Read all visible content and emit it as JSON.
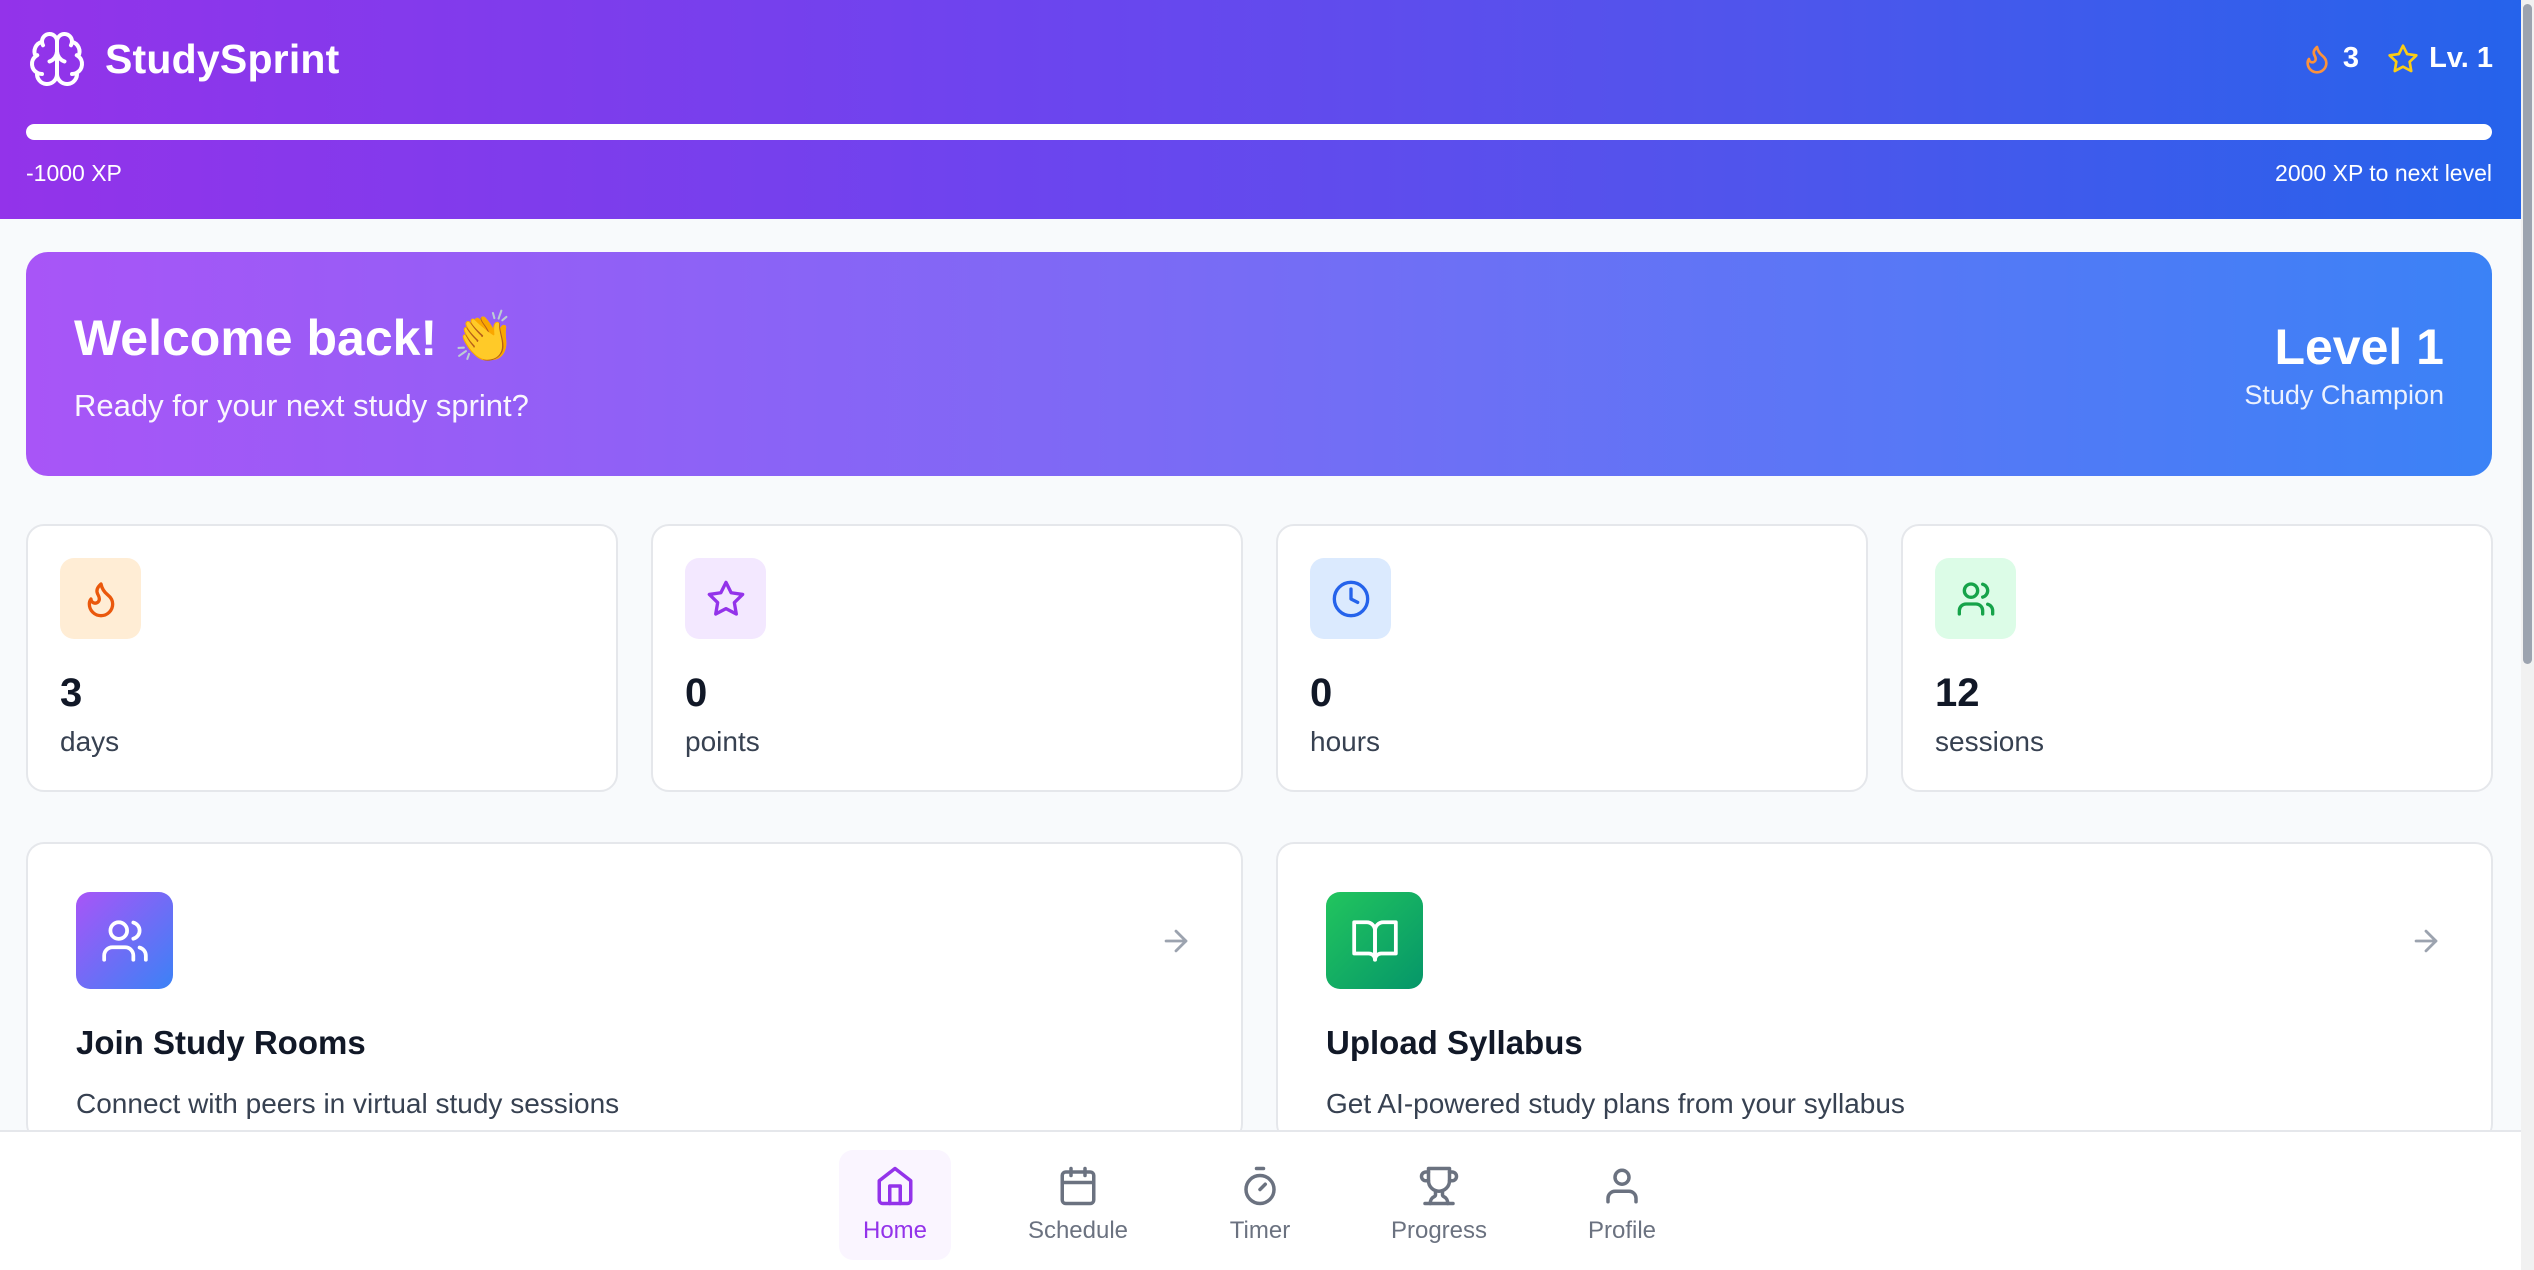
{
  "header": {
    "app_name": "StudySprint",
    "streak": "3",
    "level_badge": "Lv. 1",
    "xp_progress": 1.0,
    "xp_left": "-1000 XP",
    "xp_right": "2000 XP to next level"
  },
  "welcome": {
    "title": "Welcome back!",
    "emoji": "👏",
    "subtitle": "Ready for your next study sprint?",
    "level": "Level 1",
    "rank": "Study Champion"
  },
  "stats": [
    {
      "value": "3",
      "label": "days",
      "icon": "flame-icon",
      "color": "#ea580c",
      "bg": "#ffedd5"
    },
    {
      "value": "0",
      "label": "points",
      "icon": "star-icon",
      "color": "#9333ea",
      "bg": "#f3e8ff"
    },
    {
      "value": "0",
      "label": "hours",
      "icon": "clock-icon",
      "color": "#2563eb",
      "bg": "#dbeafe"
    },
    {
      "value": "12",
      "label": "sessions",
      "icon": "users-icon",
      "color": "#16a34a",
      "bg": "#dcfce7"
    }
  ],
  "actions": [
    {
      "title": "Join Study Rooms",
      "description": "Connect with peers in virtual study sessions",
      "icon": "users-icon"
    },
    {
      "title": "Upload Syllabus",
      "description": "Get AI-powered study plans from your syllabus",
      "icon": "book-open-icon"
    }
  ],
  "nav": [
    {
      "label": "Home",
      "icon": "home-icon",
      "active": true
    },
    {
      "label": "Schedule",
      "icon": "calendar-icon",
      "active": false
    },
    {
      "label": "Timer",
      "icon": "timer-icon",
      "active": false
    },
    {
      "label": "Progress",
      "icon": "trophy-icon",
      "active": false
    },
    {
      "label": "Profile",
      "icon": "user-icon",
      "active": false
    }
  ],
  "colors": {
    "accent": "#9333ea",
    "brand_blue": "#2563eb"
  }
}
